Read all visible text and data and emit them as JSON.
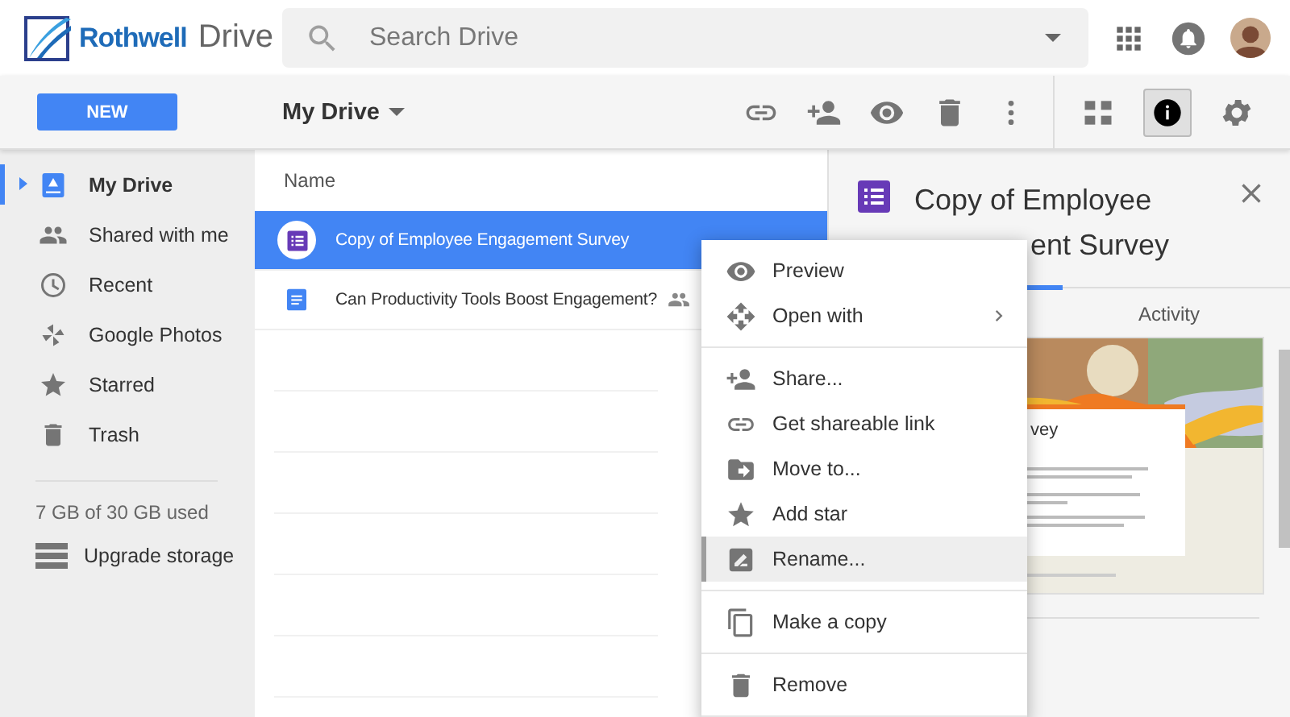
{
  "header": {
    "logo_brand": "Rothwell",
    "logo_product": "Drive",
    "search": {
      "placeholder": "Search Drive"
    }
  },
  "toolbar": {
    "new_button": "NEW",
    "location": "My Drive",
    "info_selected": true
  },
  "sidebar": {
    "items": [
      {
        "label": "My Drive",
        "selected": true
      },
      {
        "label": "Shared with me",
        "selected": false
      },
      {
        "label": "Recent",
        "selected": false
      },
      {
        "label": "Google Photos",
        "selected": false
      },
      {
        "label": "Starred",
        "selected": false
      },
      {
        "label": "Trash",
        "selected": false
      }
    ],
    "storage": "7 GB of 30 GB used",
    "upgrade": "Upgrade storage"
  },
  "file_list": {
    "column": "Name",
    "rows": [
      {
        "name": "Copy of Employee Engagement Survey",
        "kind": "form",
        "selected": true,
        "shared": false
      },
      {
        "name": "Can Productivity Tools Boost Engagement?",
        "kind": "doc",
        "selected": false,
        "shared": true
      }
    ]
  },
  "details": {
    "title_line_1": "Copy of Employee",
    "title_line_2": "ent Survey",
    "tabs": [
      {
        "label": "Activity",
        "selected": false
      }
    ],
    "preview": {
      "kind": "picture",
      "heading": "vey"
    }
  },
  "context_menu": {
    "groups": [
      {
        "items": [
          {
            "label": "Preview",
            "highlighted": false,
            "submenu": false
          },
          {
            "label": "Open with",
            "highlighted": false,
            "submenu": true
          }
        ]
      },
      {
        "items": [
          {
            "label": "Share...",
            "highlighted": false,
            "submenu": false
          },
          {
            "label": "Get shareable link",
            "highlighted": false,
            "submenu": false
          },
          {
            "label": "Move to...",
            "highlighted": false,
            "submenu": false
          },
          {
            "label": "Add star",
            "highlighted": false,
            "submenu": false
          },
          {
            "label": "Rename...",
            "highlighted": true,
            "submenu": false
          }
        ]
      },
      {
        "items": [
          {
            "label": "Make a copy",
            "highlighted": false,
            "submenu": false
          }
        ]
      },
      {
        "items": [
          {
            "label": "Remove",
            "highlighted": false,
            "submenu": false
          }
        ]
      }
    ]
  }
}
